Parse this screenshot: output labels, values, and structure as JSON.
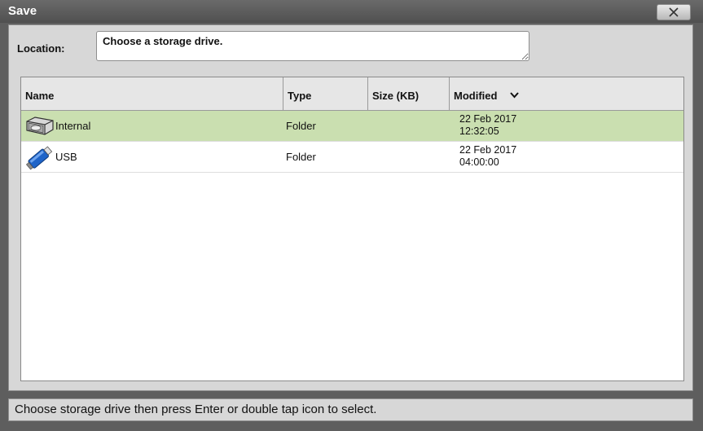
{
  "window": {
    "title": "Save",
    "close_icon": "close-icon"
  },
  "location": {
    "label": "Location:",
    "value": "Choose a storage drive."
  },
  "table": {
    "columns": {
      "name": "Name",
      "type": "Type",
      "size": "Size (KB)",
      "modified": "Modified"
    },
    "sort_icon": "chevron-down-icon",
    "rows": [
      {
        "icon": "hard-drive-icon",
        "name": "Internal",
        "type": "Folder",
        "size": "",
        "modified_date": "22 Feb 2017",
        "modified_time": "12:32:05",
        "selected": true
      },
      {
        "icon": "usb-drive-icon",
        "name": "USB",
        "type": "Folder",
        "size": "",
        "modified_date": "22 Feb 2017",
        "modified_time": "04:00:00",
        "selected": false
      }
    ]
  },
  "status": {
    "text": "Choose storage drive then press Enter or double tap icon to select."
  },
  "colors": {
    "selected_row": "#cadfb0",
    "titlebar": "#5e5e5e"
  }
}
